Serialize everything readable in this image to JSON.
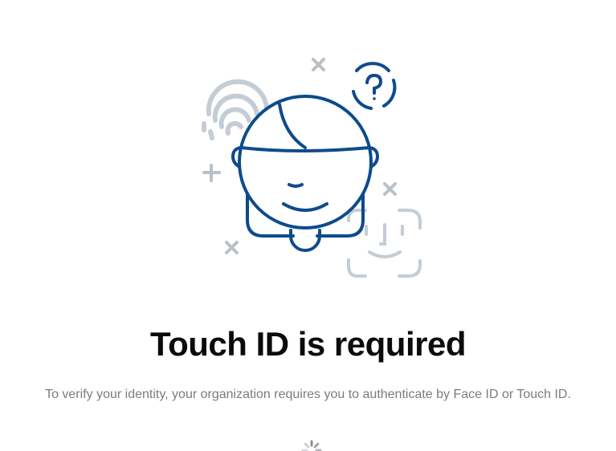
{
  "auth_prompt": {
    "title": "Touch ID is required",
    "message": "To verify your identity, your organization requires you to authenticate by Face ID or Touch ID."
  },
  "illustration": {
    "icons": [
      "person-avatar",
      "fingerprint-icon",
      "face-id-icon",
      "question-mark-icon",
      "sparkle-cross-icon",
      "plus-icon"
    ]
  },
  "loading_indicator": {
    "icon": "activity-spinner"
  },
  "colors": {
    "primary_stroke": "#0d4b8c",
    "secondary_stroke": "#c4cdd6",
    "decoration": "#b7c1ca",
    "title_text": "#0b0b0c",
    "message_text": "#7c7c80",
    "background": "#ffffff"
  }
}
